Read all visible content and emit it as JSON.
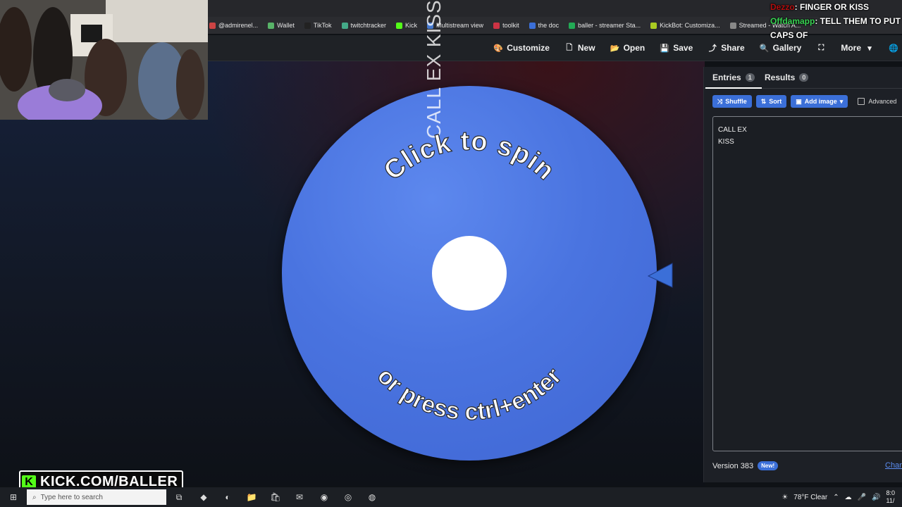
{
  "bookmarks": [
    {
      "label": "@admirenel...",
      "color": "#cc4444"
    },
    {
      "label": "Wallet",
      "color": "#58b368"
    },
    {
      "label": "TikTok",
      "color": "#222222"
    },
    {
      "label": "twitchtracker",
      "color": "#44aa88"
    },
    {
      "label": "Kick",
      "color": "#53fc18"
    },
    {
      "label": "Multistream view",
      "color": "#4477cc"
    },
    {
      "label": "toolkit",
      "color": "#cc3344"
    },
    {
      "label": "the doc",
      "color": "#3b6fd8"
    },
    {
      "label": "baller - streamer Sta...",
      "color": "#22aa55"
    },
    {
      "label": "KickBot: Customiza...",
      "color": "#aacc22"
    },
    {
      "label": "Streamed - Watch A...",
      "color": "#888888"
    }
  ],
  "toolbar": {
    "customize": "Customize",
    "new": "New",
    "open": "Open",
    "save": "Save",
    "share": "Share",
    "gallery": "Gallery",
    "more": "More"
  },
  "wheel": {
    "prompt_top": "Click to spin",
    "prompt_bottom": "or press ctrl+enter",
    "slice_label": "CALL EX KISS"
  },
  "panel": {
    "tab_entries": "Entries",
    "entries_count": "1",
    "tab_results": "Results",
    "results_count": "0",
    "shuffle": "Shuffle",
    "sort": "Sort",
    "add_image": "Add image",
    "advanced": "Advanced",
    "entries_lines": [
      "CALL EX",
      "KISS"
    ],
    "version": "Version 383",
    "new_badge": "New!",
    "changelog": "Chan"
  },
  "chat": [
    {
      "user": "Dezzo",
      "message": ": FINGER OR KISS"
    },
    {
      "user": "Offdamapp",
      "message": ": TELL THEM TO PUT CAPS OF"
    }
  ],
  "kick_banner": "KICK.COM/BALLER",
  "taskbar": {
    "search_placeholder": "Type here to search",
    "weather": "78°F  Clear",
    "time": "8:0",
    "date": "11/"
  },
  "colors": {
    "accent": "#3b6fd8",
    "wheel": "#4a74e0",
    "kick_green": "#53fc18"
  }
}
